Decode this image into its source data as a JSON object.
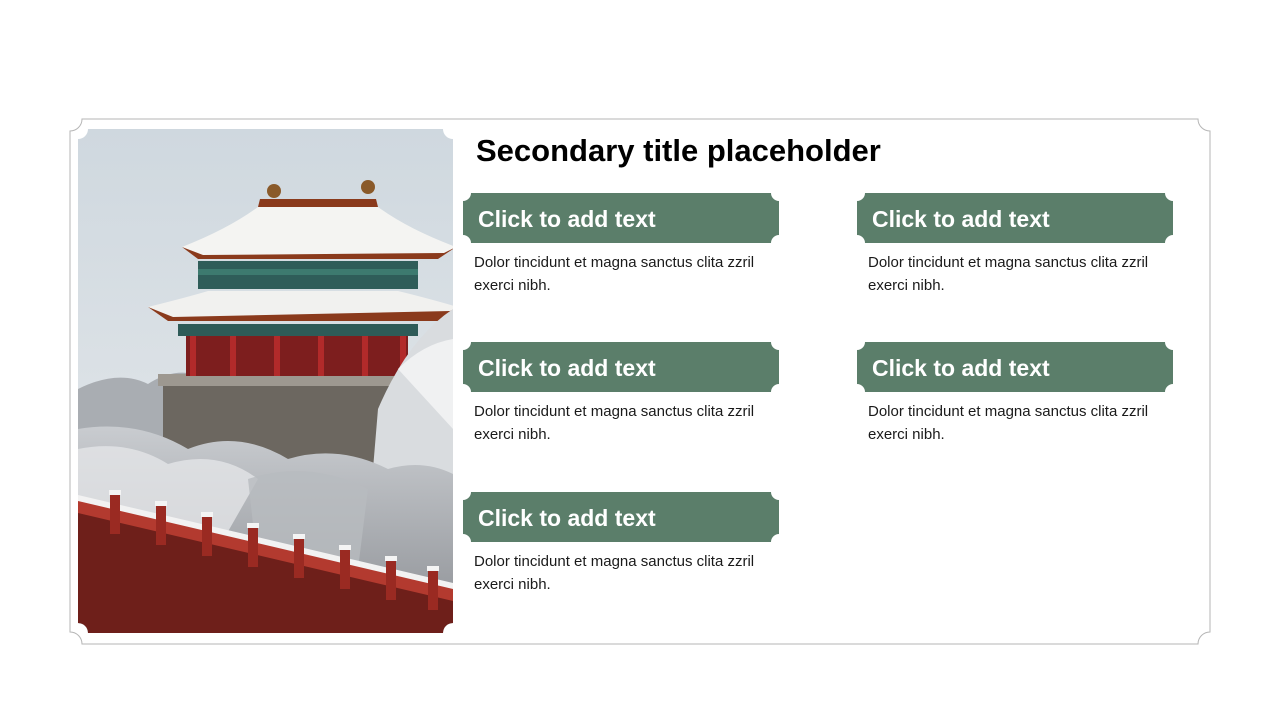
{
  "colors": {
    "accent": "#5b7e6a",
    "frame_border": "#b5b5b5",
    "text": "#1a1a1a"
  },
  "slide": {
    "title": "Secondary title placeholder",
    "image": {
      "subject": "snow-covered-pagoda-icon"
    },
    "items": [
      {
        "label": "Click to add text",
        "desc": "Dolor tincidunt et magna sanctus clita zzril exerci nibh."
      },
      {
        "label": "Click to add text",
        "desc": "Dolor tincidunt et magna sanctus clita zzril exerci nibh."
      },
      {
        "label": "Click to add text",
        "desc": "Dolor tincidunt et magna sanctus clita zzril exerci nibh."
      },
      {
        "label": "Click to add text",
        "desc": "Dolor tincidunt et magna sanctus clita zzril exerci nibh."
      },
      {
        "label": "Click to add text",
        "desc": "Dolor tincidunt et magna sanctus clita zzril exerci nibh."
      }
    ]
  }
}
